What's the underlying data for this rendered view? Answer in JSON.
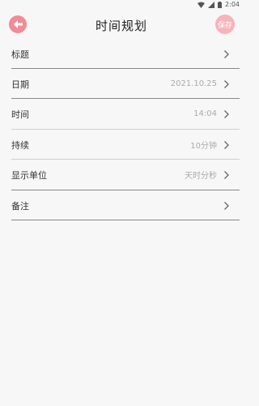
{
  "status_bar": {
    "time": "2:04"
  },
  "header": {
    "title": "时间规划",
    "save_label": "保存"
  },
  "rows": [
    {
      "label": "标题",
      "value": ""
    },
    {
      "label": "日期",
      "value": "2021.10.25"
    },
    {
      "label": "时间",
      "value": "14:04"
    },
    {
      "label": "持续",
      "value": "10分钟"
    },
    {
      "label": "显示单位",
      "value": "天时分秒"
    },
    {
      "label": "备注",
      "value": ""
    }
  ],
  "colors": {
    "accent": "#f08c98",
    "save_bg": "#f6b3ba",
    "background": "#f7f7f7"
  }
}
